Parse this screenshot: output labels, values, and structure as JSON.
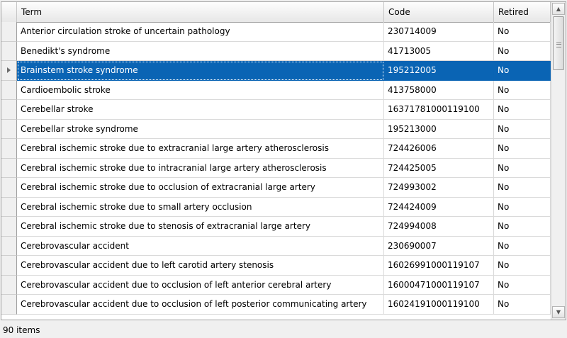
{
  "grid": {
    "columns": {
      "term": "Term",
      "code": "Code",
      "retired": "Retired"
    },
    "selected_row": 2,
    "selection_color": "#0a64b4",
    "rows": [
      {
        "term": "Anterior circulation stroke of uncertain pathology",
        "code": "230714009",
        "retired": "No"
      },
      {
        "term": "Benedikt's syndrome",
        "code": "41713005",
        "retired": "No"
      },
      {
        "term": "Brainstem stroke syndrome",
        "code": "195212005",
        "retired": "No"
      },
      {
        "term": "Cardioembolic stroke",
        "code": "413758000",
        "retired": "No"
      },
      {
        "term": "Cerebellar stroke",
        "code": "16371781000119100",
        "retired": "No"
      },
      {
        "term": "Cerebellar stroke syndrome",
        "code": "195213000",
        "retired": "No"
      },
      {
        "term": "Cerebral ischemic stroke due to extracranial large artery atherosclerosis",
        "code": "724426006",
        "retired": "No"
      },
      {
        "term": "Cerebral ischemic stroke due to intracranial large artery atherosclerosis",
        "code": "724425005",
        "retired": "No"
      },
      {
        "term": "Cerebral ischemic stroke due to occlusion of extracranial large artery",
        "code": "724993002",
        "retired": "No"
      },
      {
        "term": "Cerebral ischemic stroke due to small artery occlusion",
        "code": "724424009",
        "retired": "No"
      },
      {
        "term": "Cerebral ischemic stroke due to stenosis of extracranial large artery",
        "code": "724994008",
        "retired": "No"
      },
      {
        "term": "Cerebrovascular accident",
        "code": "230690007",
        "retired": "No"
      },
      {
        "term": "Cerebrovascular accident due to left carotid artery stenosis",
        "code": "16026991000119107",
        "retired": "No"
      },
      {
        "term": "Cerebrovascular accident due to occlusion of left anterior cerebral artery",
        "code": "16000471000119107",
        "retired": "No"
      },
      {
        "term": "Cerebrovascular accident due to occlusion of left posterior communicating artery",
        "code": "16024191000119100",
        "retired": "No"
      }
    ],
    "scroll_up_icon": "triangle-up-icon",
    "scroll_down_icon": "triangle-down-icon"
  },
  "status": {
    "count_text": "90 items"
  }
}
